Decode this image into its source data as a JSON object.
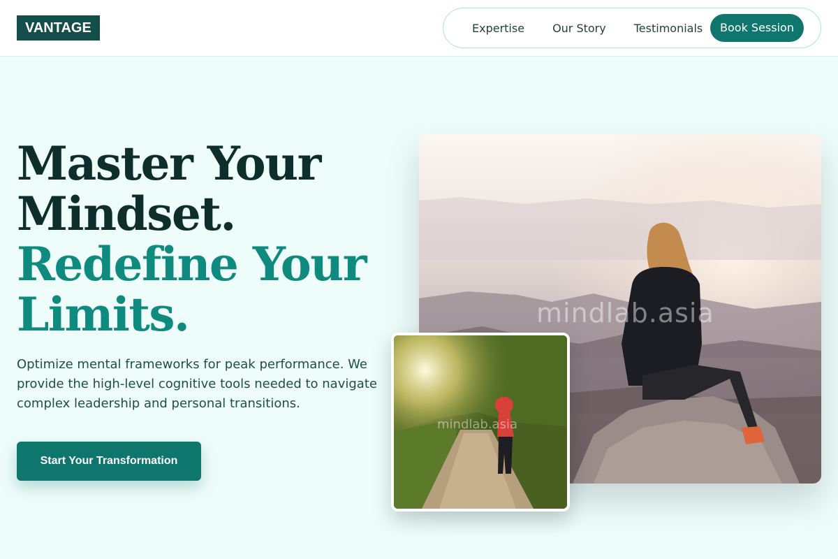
{
  "brand": {
    "logo_text": "VANTAGE"
  },
  "nav": {
    "links": [
      "Expertise",
      "Our Story",
      "Testimonials"
    ],
    "cta_label": "Book Session"
  },
  "hero": {
    "headline_line1": "Master Your",
    "headline_line2": "Mindset.",
    "headline_line3": "Redefine Your",
    "headline_line4": "Limits.",
    "description": "Optimize mental frameworks for peak performance. We provide the high-level cognitive tools needed to navigate complex leadership and personal transitions.",
    "cta_label": "Start Your Transformation"
  },
  "images": {
    "main_watermark": "mindlab.asia",
    "small_watermark": "mindlab.asia"
  },
  "colors": {
    "brand_dark": "#134e4a",
    "accent": "#0f766e",
    "headline_teal": "#0f8a7e",
    "background": "#eefcfa"
  }
}
